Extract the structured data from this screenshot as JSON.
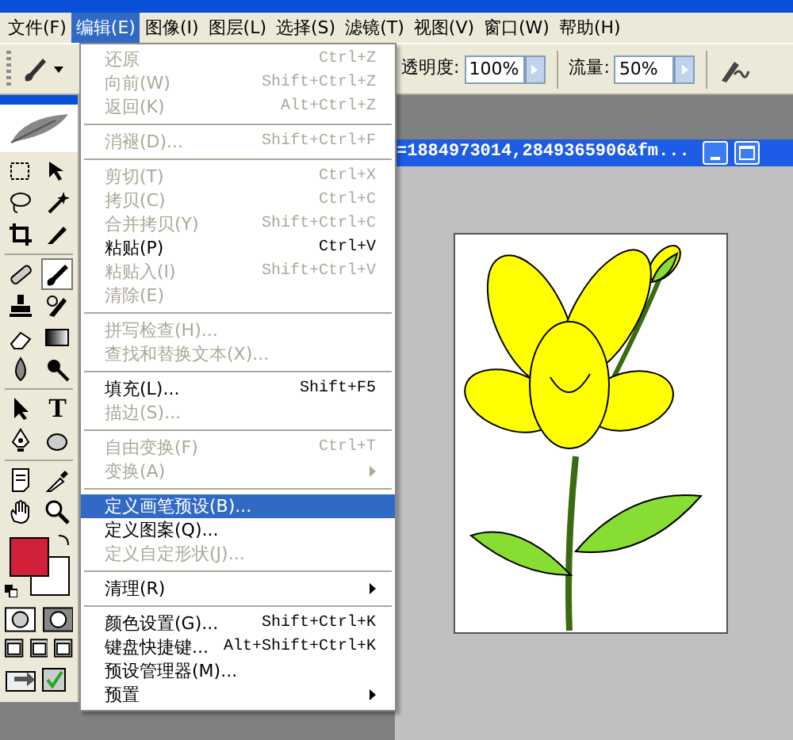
{
  "menu_bar": [
    {
      "label": "文件(F)",
      "selected": false
    },
    {
      "label": "编辑(E)",
      "selected": true
    },
    {
      "label": "图像(I)",
      "selected": false
    },
    {
      "label": "图层(L)",
      "selected": false
    },
    {
      "label": "选择(S)",
      "selected": false
    },
    {
      "label": "滤镜(T)",
      "selected": false
    },
    {
      "label": "视图(V)",
      "selected": false
    },
    {
      "label": "窗口(W)",
      "selected": false
    },
    {
      "label": "帮助(H)",
      "selected": false
    }
  ],
  "options_bar": {
    "opacity_label": "透明度:",
    "opacity": "100%",
    "flow_label": "流量:",
    "flow": "50%"
  },
  "toolbox": {
    "type_tool_glyph": "T"
  },
  "edit_menu": [
    {
      "kind": "item",
      "label": "还原",
      "shortcut": "Ctrl+Z",
      "disabled": true,
      "selected": false,
      "submenu": false
    },
    {
      "kind": "item",
      "label": "向前(W)",
      "shortcut": "Shift+Ctrl+Z",
      "disabled": true,
      "selected": false,
      "submenu": false
    },
    {
      "kind": "item",
      "label": "返回(K)",
      "shortcut": "Alt+Ctrl+Z",
      "disabled": true,
      "selected": false,
      "submenu": false
    },
    {
      "kind": "separator"
    },
    {
      "kind": "item",
      "label": "消褪(D)...",
      "shortcut": "Shift+Ctrl+F",
      "disabled": true,
      "selected": false,
      "submenu": false
    },
    {
      "kind": "separator"
    },
    {
      "kind": "item",
      "label": "剪切(T)",
      "shortcut": "Ctrl+X",
      "disabled": true,
      "selected": false,
      "submenu": false
    },
    {
      "kind": "item",
      "label": "拷贝(C)",
      "shortcut": "Ctrl+C",
      "disabled": true,
      "selected": false,
      "submenu": false
    },
    {
      "kind": "item",
      "label": "合并拷贝(Y)",
      "shortcut": "Shift+Ctrl+C",
      "disabled": true,
      "selected": false,
      "submenu": false
    },
    {
      "kind": "item",
      "label": "粘贴(P)",
      "shortcut": "Ctrl+V",
      "disabled": false,
      "selected": false,
      "submenu": false
    },
    {
      "kind": "item",
      "label": "粘贴入(I)",
      "shortcut": "Shift+Ctrl+V",
      "disabled": true,
      "selected": false,
      "submenu": false
    },
    {
      "kind": "item",
      "label": "清除(E)",
      "disabled": true,
      "selected": false,
      "submenu": false
    },
    {
      "kind": "separator"
    },
    {
      "kind": "item",
      "label": "拼写检查(H)...",
      "disabled": true,
      "selected": false,
      "submenu": false
    },
    {
      "kind": "item",
      "label": "查找和替换文本(X)...",
      "disabled": true,
      "selected": false,
      "submenu": false
    },
    {
      "kind": "separator"
    },
    {
      "kind": "item",
      "label": "填充(L)...",
      "shortcut": "Shift+F5",
      "disabled": false,
      "selected": false,
      "submenu": false
    },
    {
      "kind": "item",
      "label": "描边(S)...",
      "disabled": true,
      "selected": false,
      "submenu": false
    },
    {
      "kind": "separator"
    },
    {
      "kind": "item",
      "label": "自由变换(F)",
      "shortcut": "Ctrl+T",
      "disabled": true,
      "selected": false,
      "submenu": false
    },
    {
      "kind": "item",
      "label": "变换(A)",
      "disabled": true,
      "selected": false,
      "submenu": true
    },
    {
      "kind": "separator"
    },
    {
      "kind": "item",
      "label": "定义画笔预设(B)...",
      "disabled": false,
      "selected": true,
      "submenu": false
    },
    {
      "kind": "item",
      "label": "定义图案(Q)...",
      "disabled": false,
      "selected": false,
      "submenu": false
    },
    {
      "kind": "item",
      "label": "定义自定形状(J)...",
      "disabled": true,
      "selected": false,
      "submenu": false
    },
    {
      "kind": "separator"
    },
    {
      "kind": "item",
      "label": "清理(R)",
      "disabled": false,
      "selected": false,
      "submenu": true
    },
    {
      "kind": "separator"
    },
    {
      "kind": "item",
      "label": "颜色设置(G)...",
      "shortcut": "Shift+Ctrl+K",
      "disabled": false,
      "selected": false,
      "submenu": false
    },
    {
      "kind": "item",
      "label": "键盘快捷键...",
      "shortcut": "Alt+Shift+Ctrl+K",
      "disabled": false,
      "selected": false,
      "submenu": false
    },
    {
      "kind": "item",
      "label": "预设管理器(M)...",
      "disabled": false,
      "selected": false,
      "submenu": false
    },
    {
      "kind": "item",
      "label": "预置",
      "disabled": false,
      "selected": false,
      "submenu": true
    }
  ],
  "document": {
    "title": "=1884973014,2849365906&fm..."
  }
}
